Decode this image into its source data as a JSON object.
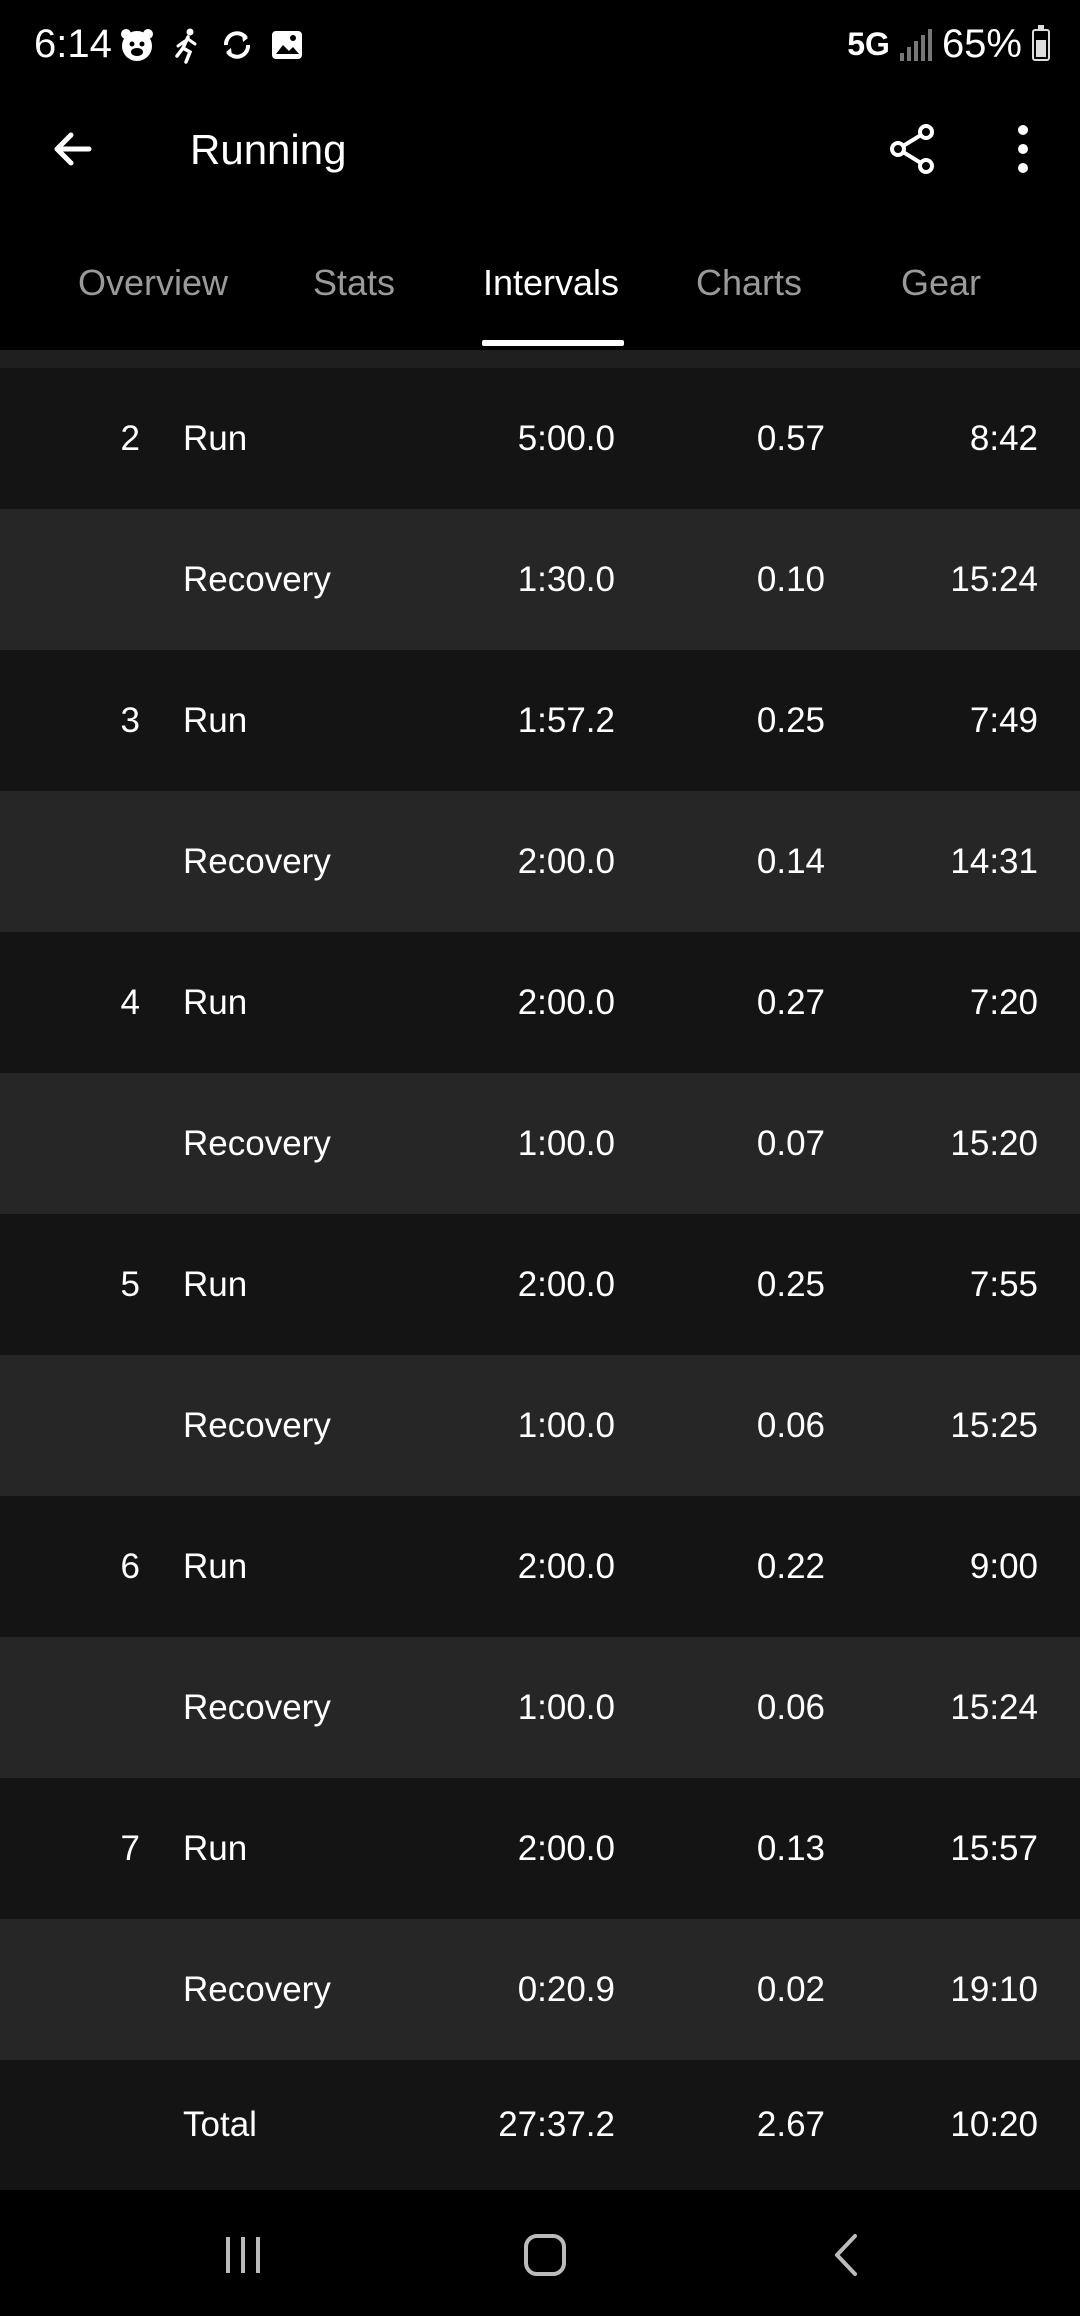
{
  "status_bar": {
    "time": "6:14",
    "network": "5G",
    "battery": "65%"
  },
  "app_bar": {
    "title": "Running"
  },
  "tabs": [
    {
      "label": "Overview",
      "active": false
    },
    {
      "label": "Stats",
      "active": false
    },
    {
      "label": "Intervals",
      "active": true
    },
    {
      "label": "Charts",
      "active": false
    },
    {
      "label": "Gear",
      "active": false
    }
  ],
  "intervals": [
    {
      "num": "2",
      "type": "Run",
      "time": "5:00.0",
      "distance": "0.57",
      "pace": "8:42"
    },
    {
      "num": "",
      "type": "Recovery",
      "time": "1:30.0",
      "distance": "0.10",
      "pace": "15:24"
    },
    {
      "num": "3",
      "type": "Run",
      "time": "1:57.2",
      "distance": "0.25",
      "pace": "7:49"
    },
    {
      "num": "",
      "type": "Recovery",
      "time": "2:00.0",
      "distance": "0.14",
      "pace": "14:31"
    },
    {
      "num": "4",
      "type": "Run",
      "time": "2:00.0",
      "distance": "0.27",
      "pace": "7:20"
    },
    {
      "num": "",
      "type": "Recovery",
      "time": "1:00.0",
      "distance": "0.07",
      "pace": "15:20"
    },
    {
      "num": "5",
      "type": "Run",
      "time": "2:00.0",
      "distance": "0.25",
      "pace": "7:55"
    },
    {
      "num": "",
      "type": "Recovery",
      "time": "1:00.0",
      "distance": "0.06",
      "pace": "15:25"
    },
    {
      "num": "6",
      "type": "Run",
      "time": "2:00.0",
      "distance": "0.22",
      "pace": "9:00"
    },
    {
      "num": "",
      "type": "Recovery",
      "time": "1:00.0",
      "distance": "0.06",
      "pace": "15:24"
    },
    {
      "num": "7",
      "type": "Run",
      "time": "2:00.0",
      "distance": "0.13",
      "pace": "15:57"
    },
    {
      "num": "",
      "type": "Recovery",
      "time": "0:20.9",
      "distance": "0.02",
      "pace": "19:10"
    }
  ],
  "total": {
    "label": "Total",
    "time": "27:37.2",
    "distance": "2.67",
    "pace": "10:20"
  },
  "icons": {
    "back": "arrow-left-icon",
    "share": "share-icon",
    "more": "more-vertical-icon",
    "nav_recents": "recents-icon",
    "nav_home": "home-icon",
    "nav_back": "chevron-left-icon"
  },
  "colors": {
    "background": "#000000",
    "row_dark": "#141414",
    "row_light": "#262626",
    "tab_inactive": "#9a9a9a",
    "tab_active": "#ffffff"
  }
}
